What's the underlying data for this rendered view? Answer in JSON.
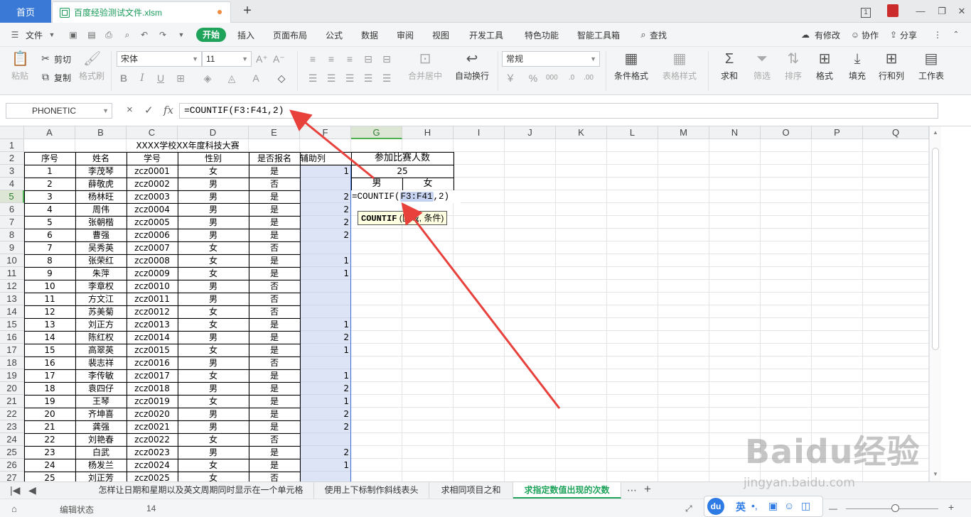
{
  "titlebar": {
    "home_tab": "首页",
    "file_tab": "百度经验测试文件.xlsm",
    "new_tab": "+",
    "page_count": "1"
  },
  "menubar": {
    "file": "文件",
    "items": [
      "开始",
      "插入",
      "页面布局",
      "公式",
      "数据",
      "审阅",
      "视图",
      "开发工具",
      "特色功能",
      "智能工具箱",
      "查找"
    ],
    "right": [
      "有修改",
      "协作",
      "分享"
    ]
  },
  "toolbar": {
    "paste": "粘贴",
    "cut": "剪切",
    "copy": "复制",
    "format_painter": "格式刷",
    "font_name": "宋体",
    "font_size": "11",
    "merge_center": "合并居中",
    "wrap_text": "自动换行",
    "number_format": "常规",
    "currency": "￥",
    "conditional_format": "条件格式",
    "table_style": "表格样式",
    "sum": "求和",
    "filter": "筛选",
    "sort": "排序",
    "format": "格式",
    "fill": "填充",
    "row_col": "行和列",
    "worksheet": "工作表"
  },
  "formula_bar": {
    "name_box": "PHONETIC",
    "cancel": "×",
    "confirm": "✓",
    "fx": "fx",
    "formula": "=COUNTIF(F3:F41,2)"
  },
  "sheet": {
    "columns": [
      "A",
      "B",
      "C",
      "D",
      "E",
      "F",
      "G",
      "H",
      "I",
      "J",
      "K",
      "L",
      "M",
      "N",
      "O",
      "P",
      "Q"
    ],
    "rows": [
      "1",
      "2",
      "3",
      "4",
      "5",
      "6",
      "7",
      "8",
      "9",
      "10",
      "11",
      "12",
      "13",
      "14",
      "15",
      "16",
      "17",
      "18",
      "19",
      "20",
      "21",
      "22",
      "23",
      "24",
      "25",
      "26",
      "27"
    ],
    "title": "XXXX学校XX年度科技大赛",
    "headers": [
      "序号",
      "姓名",
      "学号",
      "性别",
      "是否报名",
      "辅助列"
    ],
    "records": [
      [
        "1",
        "李茂琴",
        "zcz0001",
        "女",
        "是",
        "1"
      ],
      [
        "2",
        "薛敬虎",
        "zcz0002",
        "男",
        "否",
        ""
      ],
      [
        "3",
        "杨林旺",
        "zcz0003",
        "男",
        "是",
        "2"
      ],
      [
        "4",
        "周伟",
        "zcz0004",
        "男",
        "是",
        "2"
      ],
      [
        "5",
        "张朝楷",
        "zcz0005",
        "男",
        "是",
        "2"
      ],
      [
        "6",
        "曹强",
        "zcz0006",
        "男",
        "是",
        "2"
      ],
      [
        "7",
        "吴秀英",
        "zcz0007",
        "女",
        "否",
        ""
      ],
      [
        "8",
        "张荣红",
        "zcz0008",
        "女",
        "是",
        "1"
      ],
      [
        "9",
        "朱萍",
        "zcz0009",
        "女",
        "是",
        "1"
      ],
      [
        "10",
        "李章权",
        "zcz0010",
        "男",
        "否",
        ""
      ],
      [
        "11",
        "方文江",
        "zcz0011",
        "男",
        "否",
        ""
      ],
      [
        "12",
        "苏美菊",
        "zcz0012",
        "女",
        "否",
        ""
      ],
      [
        "13",
        "刘正方",
        "zcz0013",
        "女",
        "是",
        "1"
      ],
      [
        "14",
        "陈红权",
        "zcz0014",
        "男",
        "是",
        "2"
      ],
      [
        "15",
        "高翠英",
        "zcz0015",
        "女",
        "是",
        "1"
      ],
      [
        "16",
        "裴志祥",
        "zcz0016",
        "男",
        "否",
        ""
      ],
      [
        "17",
        "李传敏",
        "zcz0017",
        "女",
        "是",
        "1"
      ],
      [
        "18",
        "袁四仔",
        "zcz0018",
        "男",
        "是",
        "2"
      ],
      [
        "19",
        "王琴",
        "zcz0019",
        "女",
        "是",
        "1"
      ],
      [
        "20",
        "齐坤喜",
        "zcz0020",
        "男",
        "是",
        "2"
      ],
      [
        "21",
        "龚强",
        "zcz0021",
        "男",
        "是",
        "2"
      ],
      [
        "22",
        "刘艳春",
        "zcz0022",
        "女",
        "否",
        ""
      ],
      [
        "23",
        "白武",
        "zcz0023",
        "男",
        "是",
        "2"
      ],
      [
        "24",
        "杨发兰",
        "zcz0024",
        "女",
        "是",
        "1"
      ],
      [
        "25",
        "刘正芳",
        "zcz0025",
        "女",
        "否",
        ""
      ]
    ],
    "summary": {
      "header": "参加比赛人数",
      "total": "25",
      "male": "男",
      "female": "女"
    },
    "editing": {
      "prefix": "=COUNTIF(",
      "ref": "F3:F41",
      "suffix": ",2)"
    },
    "tooltip": {
      "func": "COUNTIF",
      "args": " (区域, 条件)"
    }
  },
  "sheet_tabs": {
    "tabs": [
      "怎样让日期和星期以及英文周期同时显示在一个单元格",
      "使用上下标制作斜线表头",
      "求相同项目之和",
      "求指定数值出现的次数"
    ],
    "active_index": 3,
    "more": "⋯",
    "add": "+"
  },
  "statusbar": {
    "mode": "编辑状态",
    "value": "14"
  },
  "ime": {
    "logo": "du",
    "lang": "英"
  },
  "watermark": {
    "logo": "Baidu经验",
    "url": "jingyan.baidu.com"
  },
  "colors": {
    "accent": "#1fa35b",
    "home_tab": "#3a7ad6",
    "selection_fill": "#b4c4ec",
    "arrow": "#e8413c"
  }
}
